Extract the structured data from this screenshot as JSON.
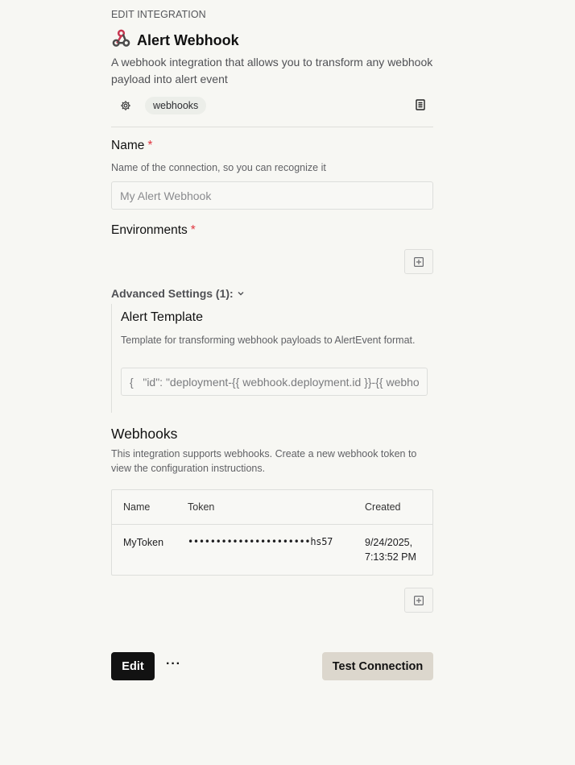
{
  "header": {
    "eyebrow": "EDIT INTEGRATION",
    "title": "Alert Webhook",
    "description": "A webhook integration that allows you to transform any webhook payload into alert event",
    "tag": "webhooks"
  },
  "name_field": {
    "label": "Name",
    "required_mark": "*",
    "help": "Name of the connection, so you can recognize it",
    "placeholder": "My Alert Webhook",
    "value": ""
  },
  "environments": {
    "label": "Environments",
    "required_mark": "*"
  },
  "advanced": {
    "label": "Advanced Settings (1):",
    "template_label": "Alert Template",
    "template_help": "Template for transforming webhook payloads to AlertEvent format.",
    "template_value": "{   \"id\": \"deployment-{{ webhook.deployment.id }}-{{ webhook.deployment.status }}\""
  },
  "webhooks": {
    "title": "Webhooks",
    "help": "This integration supports webhooks. Create a new webhook token to view the configuration instructions.",
    "columns": [
      "Name",
      "Token",
      "Created"
    ],
    "rows": [
      {
        "name": "MyToken",
        "token": "••••••••••••••••••••••hs57",
        "created_date": "9/24/2025,",
        "created_time": "7:13:52 PM"
      }
    ]
  },
  "footer": {
    "edit_label": "Edit",
    "more_label": "···",
    "test_label": "Test Connection"
  },
  "colors": {
    "background": "#f7f7f3",
    "required": "#e0353f",
    "primary_button": "#121212",
    "secondary_button": "#dcd7cd"
  },
  "icons": [
    "webhook-logo-icon",
    "gear-icon",
    "document-icon",
    "plus-square-icon",
    "chevron-down-icon"
  ]
}
